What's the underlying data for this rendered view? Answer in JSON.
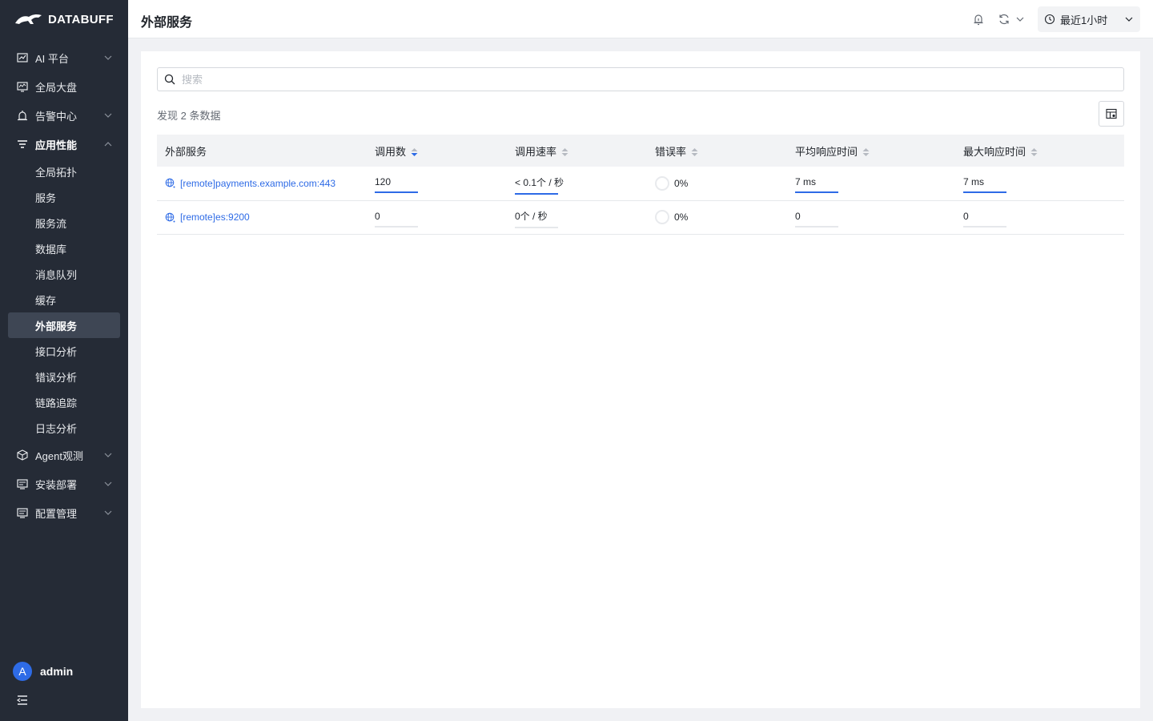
{
  "brand": {
    "name": "DATABUFF"
  },
  "sidebar": {
    "items": [
      {
        "label": "AI 平台",
        "icon": "chart-icon",
        "expandable": true
      },
      {
        "label": "全局大盘",
        "icon": "dashboard-icon",
        "expandable": false
      },
      {
        "label": "告警中心",
        "icon": "alarm-icon",
        "expandable": true
      },
      {
        "label": "应用性能",
        "icon": "list-filter-icon",
        "expandable": true,
        "expanded": true
      }
    ],
    "sub_items": [
      {
        "label": "全局拓扑"
      },
      {
        "label": "服务"
      },
      {
        "label": "服务流"
      },
      {
        "label": "数据库"
      },
      {
        "label": "消息队列"
      },
      {
        "label": "缓存"
      },
      {
        "label": "外部服务",
        "active": true
      },
      {
        "label": "接口分析"
      },
      {
        "label": "错误分析"
      },
      {
        "label": "链路追踪"
      },
      {
        "label": "日志分析"
      }
    ],
    "bottom_items": [
      {
        "label": "Agent观测",
        "icon": "cube-icon"
      },
      {
        "label": "安装部署",
        "icon": "deploy-icon"
      },
      {
        "label": "配置管理",
        "icon": "config-icon"
      }
    ],
    "user": {
      "avatar_letter": "A",
      "name": "admin"
    }
  },
  "header": {
    "title": "外部服务",
    "time_range": "最近1小时"
  },
  "main": {
    "search_placeholder": "搜索",
    "result_count": "发现 2 条数据",
    "columns": [
      "外部服务",
      "调用数",
      "调用速率",
      "错误率",
      "平均响应时间",
      "最大响应时间"
    ],
    "rows": [
      {
        "service": "[remote]payments.example.com:443",
        "calls": "120",
        "calls_fill": 1.0,
        "rate": "< 0.1个 / 秒",
        "rate_fill": 1.0,
        "error_rate": "0%",
        "avg_rt": "7 ms",
        "avg_rt_fill": 1.0,
        "max_rt": "7 ms",
        "max_rt_fill": 1.0
      },
      {
        "service": "[remote]es:9200",
        "calls": "0",
        "calls_fill": 0,
        "rate": "0个 / 秒",
        "rate_fill": 0,
        "error_rate": "0%",
        "avg_rt": "0",
        "avg_rt_fill": 0,
        "max_rt": "0",
        "max_rt_fill": 0
      }
    ]
  },
  "colors": {
    "accent": "#2e6be6",
    "sidebar_bg": "#252b36",
    "active_bg": "#3e4654"
  }
}
